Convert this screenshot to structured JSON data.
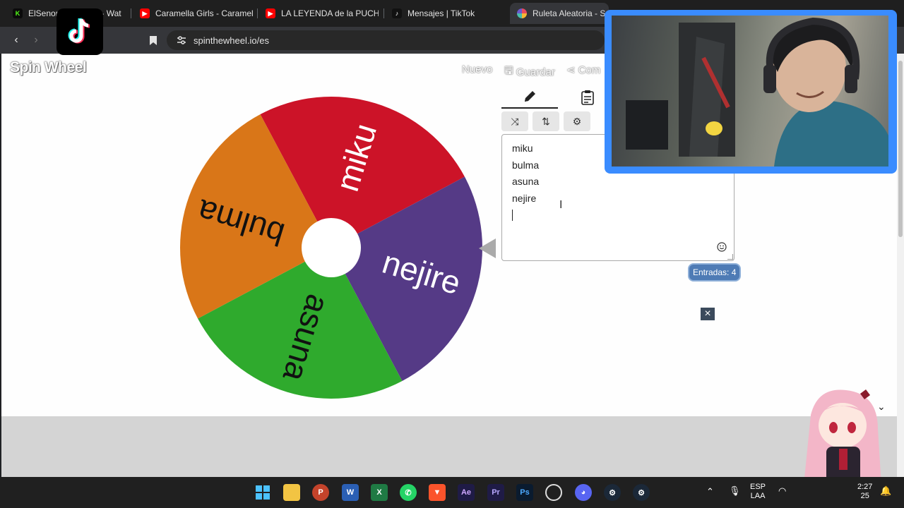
{
  "browser": {
    "tabs": [
      {
        "label": "ElSenor2",
        "tail": "- Wat",
        "icon": "kick-icon",
        "color": "#53fc18"
      },
      {
        "label": "Caramella Girls - Caramell",
        "icon": "youtube-icon",
        "color": "#ff0000"
      },
      {
        "label": "LA LEYENDA de la PUCHA",
        "icon": "youtube-icon",
        "color": "#ff0000"
      },
      {
        "label": "Mensajes | TikTok",
        "icon": "tiktok-icon",
        "color": "#000000"
      },
      {
        "label": "Ruleta Aleatoria - S",
        "icon": "wheel-icon",
        "color": "#e84a5f"
      }
    ],
    "url": "spinthewheel.io/es"
  },
  "site": {
    "logo": "Spin Wheel",
    "nav": {
      "new": "Nuevo",
      "save": "Guardar",
      "share": "Com"
    }
  },
  "wheel": {
    "segments": [
      {
        "label": "miku",
        "color": "#cc1328"
      },
      {
        "label": "nejire",
        "color": "#553a86"
      },
      {
        "label": "asuna",
        "color": "#2faa2d"
      },
      {
        "label": "bulma",
        "color": "#d97618"
      }
    ]
  },
  "editor": {
    "entries": [
      "miku",
      "bulma",
      "asuna",
      "nejire"
    ],
    "count_label": "Entradas: 4"
  },
  "taskbar": {
    "lang": "ESP",
    "layout": "LAA",
    "time": "2:27",
    "date": "25"
  }
}
